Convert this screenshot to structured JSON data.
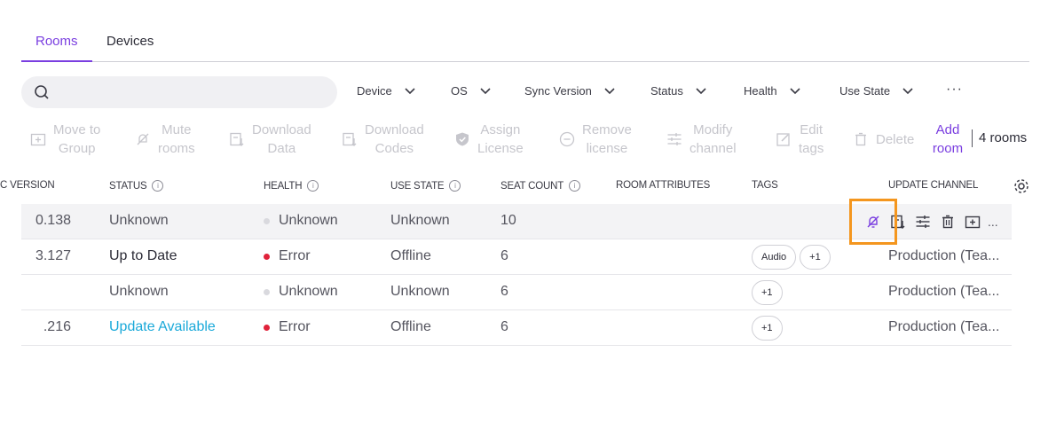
{
  "tabs": [
    {
      "label": "Rooms",
      "active": true
    },
    {
      "label": "Devices",
      "active": false
    }
  ],
  "search": {
    "placeholder": ""
  },
  "filters": [
    "Device",
    "OS",
    "Sync Version",
    "Status",
    "Health",
    "Use State"
  ],
  "filters_more": "···",
  "toolbar": {
    "move_to_group": [
      "Move to",
      "Group"
    ],
    "mute_rooms": [
      "Mute",
      "rooms"
    ],
    "download_data": [
      "Download",
      "Data"
    ],
    "download_codes": [
      "Download",
      "Codes"
    ],
    "assign_license": [
      "Assign",
      "License"
    ],
    "remove_license": [
      "Remove",
      "license"
    ],
    "modify_channel": [
      "Modify",
      "channel"
    ],
    "edit_tags": [
      "Edit",
      "tags"
    ],
    "delete": "Delete",
    "add_room": [
      "Add",
      "room"
    ],
    "room_count": "4 rooms"
  },
  "columns": {
    "sync_version": "C VERSION",
    "status": "STATUS",
    "health": "HEALTH",
    "use_state": "USE STATE",
    "seat_count": "SEAT COUNT",
    "room_attributes": "ROOM ATTRIBUTES",
    "tags": "TAGS",
    "update_channel": "UPDATE CHANNEL"
  },
  "rows": [
    {
      "version": "0.138",
      "status": "Unknown",
      "health": "Unknown",
      "use_state": "Unknown",
      "seat_count": "10",
      "tags": [],
      "channel": ""
    },
    {
      "version": "3.127",
      "status": "Up to Date",
      "health": "Error",
      "use_state": "Offline",
      "seat_count": "6",
      "tags": [
        "Audio",
        "+1"
      ],
      "channel": "Production (Tea..."
    },
    {
      "version": "",
      "status": "Unknown",
      "health": "Unknown",
      "use_state": "Unknown",
      "seat_count": "6",
      "tags": [
        "+1"
      ],
      "channel": "Production (Tea..."
    },
    {
      "version": ".216",
      "status": "Update Available",
      "health": "Error",
      "use_state": "Offline",
      "seat_count": "6",
      "tags": [
        "+1"
      ],
      "channel": "Production (Tea..."
    }
  ],
  "row_actions_more": "...",
  "colors": {
    "accent": "#7a3ee0",
    "error": "#e0223a",
    "update_available": "#1aa9d9",
    "highlight": "#f4961e"
  }
}
